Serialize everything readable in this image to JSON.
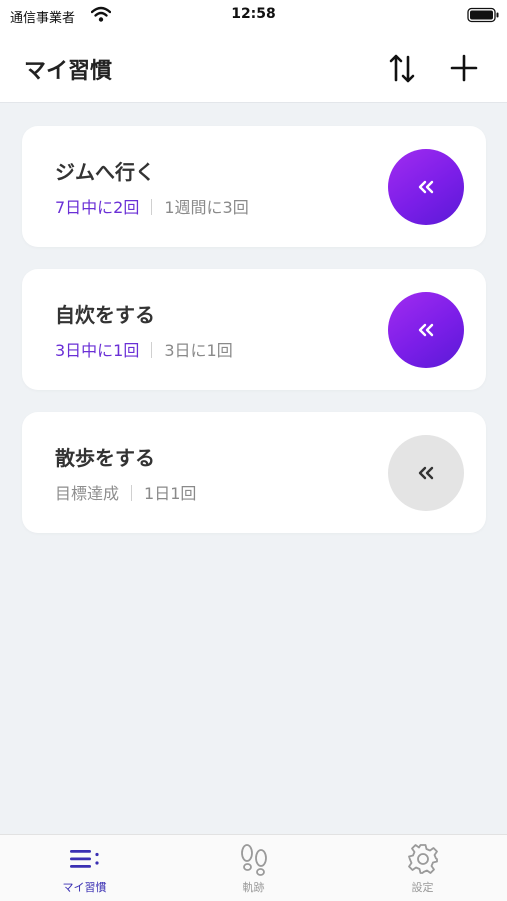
{
  "status_bar": {
    "carrier": "通信事業者",
    "time": "12:58"
  },
  "header": {
    "title": "マイ習慣"
  },
  "habits": [
    {
      "name": "ジムへ行く",
      "progress": "7日中に2回",
      "goal": "1週間に3回",
      "state": "active"
    },
    {
      "name": "自炊をする",
      "progress": "3日中に1回",
      "goal": "3日に1回",
      "state": "active"
    },
    {
      "name": "散歩をする",
      "progress": "目標達成",
      "goal": "1日1回",
      "state": "done"
    }
  ],
  "tabs": [
    {
      "label": "マイ習慣",
      "icon": "list-icon",
      "selected": true
    },
    {
      "label": "軌跡",
      "icon": "footprints-icon",
      "selected": false
    },
    {
      "label": "設定",
      "icon": "gear-icon",
      "selected": false
    }
  ],
  "colors": {
    "accent": "#6a2fd6",
    "button_gradient_start": "#a12cf0",
    "button_gradient_end": "#5a1ad6",
    "tab_selected": "#3a2fb3",
    "background": "#eff2f5"
  }
}
